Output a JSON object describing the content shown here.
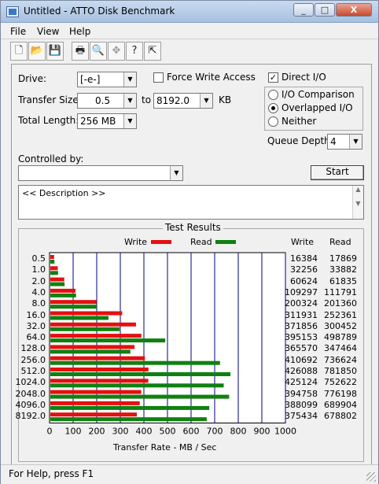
{
  "window": {
    "title": "Untitled - ATTO Disk Benchmark",
    "minimize": "_",
    "maximize": "□",
    "close": "X"
  },
  "menu": {
    "file": "File",
    "view": "View",
    "help": "Help"
  },
  "toolbar_icons": [
    "new-document-icon",
    "open-folder-icon",
    "save-icon",
    "print-icon",
    "print-preview-icon",
    "move-icon",
    "help-icon",
    "context-help-icon"
  ],
  "settings": {
    "drive_label": "Drive:",
    "drive_value": "[-e-]",
    "force_write_label": "Force Write Access",
    "force_write_checked": false,
    "direct_io_label": "Direct I/O",
    "direct_io_checked": true,
    "transfer_size_label": "Transfer Size:",
    "transfer_from": "0.5",
    "to_label": "to",
    "transfer_to": "8192.0",
    "kb_label": "KB",
    "total_length_label": "Total Length:",
    "total_length_value": "256 MB",
    "io_comparison_label": "I/O Comparison",
    "overlapped_io_label": "Overlapped I/O",
    "neither_label": "Neither",
    "selected_mode": "Overlapped I/O",
    "queue_depth_label": "Queue Depth:",
    "queue_depth_value": "4",
    "controlled_by_label": "Controlled by:",
    "controlled_by_value": "",
    "start_label": "Start",
    "description": "<< Description >>"
  },
  "results": {
    "title": "Test Results",
    "write_label": "Write",
    "read_label": "Read",
    "write_color": "#e41010",
    "read_color": "#108010",
    "col_write": "Write",
    "col_read": "Read",
    "sizes": [
      "0.5",
      "1.0",
      "2.0",
      "4.0",
      "8.0",
      "16.0",
      "32.0",
      "64.0",
      "128.0",
      "256.0",
      "512.0",
      "1024.0",
      "2048.0",
      "4096.0",
      "8192.0"
    ],
    "write": [
      16384,
      32256,
      60624,
      109297,
      200324,
      311931,
      371856,
      395153,
      365570,
      410692,
      426088,
      425124,
      394758,
      388099,
      375434
    ],
    "read": [
      17869,
      33882,
      61835,
      111791,
      201360,
      252361,
      300452,
      498789,
      347464,
      736624,
      781850,
      752622,
      776198,
      689904,
      678802
    ],
    "x_ticks": [
      "0",
      "100",
      "200",
      "300",
      "400",
      "500",
      "600",
      "700",
      "800",
      "900",
      "1000"
    ],
    "x_max": 1000,
    "x_label": "Transfer Rate - MB / Sec"
  },
  "status": {
    "text": "For Help, press F1"
  }
}
